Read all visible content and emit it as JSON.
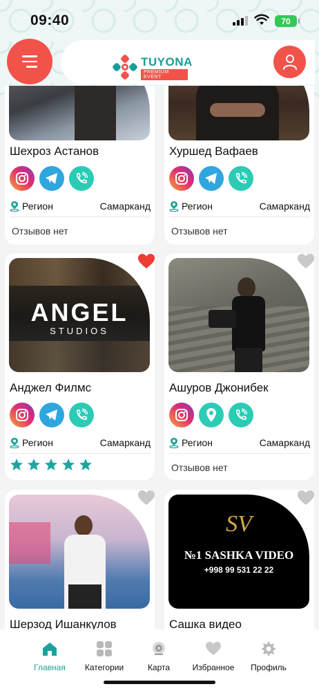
{
  "status_bar": {
    "time": "09:40",
    "battery": "70"
  },
  "header": {
    "logo_title": "TUYONA",
    "logo_subtitle": "PREMIUM EVENT"
  },
  "cards": [
    {
      "name": "Шехроз Астанов",
      "region_label": "Регион",
      "city": "Самарканд",
      "reviews": "Отзывов нет",
      "favorite": false
    },
    {
      "name": "Хуршед Вафаев",
      "region_label": "Регион",
      "city": "Самарканд",
      "reviews": "Отзывов нет",
      "favorite": false
    },
    {
      "name": "Анджел Филмс",
      "region_label": "Регион",
      "city": "Самарканд",
      "rating": 5,
      "favorite": true,
      "image_title": "ANGEL",
      "image_subtitle": "STUDIOS"
    },
    {
      "name": "Ашуров Джонибек",
      "region_label": "Регион",
      "city": "Самарканд",
      "reviews": "Отзывов нет",
      "favorite": false
    },
    {
      "name": "Шерзод Ишанкулов",
      "favorite": false
    },
    {
      "name": "Сашка видео",
      "favorite": false,
      "image_logo": "SV",
      "image_title": "№1 SASHKA VIDEO",
      "image_phone": "+998 99 531 22 22"
    }
  ],
  "bottom_nav": [
    {
      "label": "Главная",
      "icon": "home-icon",
      "active": true
    },
    {
      "label": "Категории",
      "icon": "grid-icon",
      "active": false
    },
    {
      "label": "Карта",
      "icon": "map-icon",
      "active": false
    },
    {
      "label": "Избранное",
      "icon": "heart-icon",
      "active": false
    },
    {
      "label": "Профиль",
      "icon": "gear-icon",
      "active": false
    }
  ],
  "colors": {
    "accent": "#f1534b",
    "teal": "#1aa39b",
    "star": "#1fa5a0"
  }
}
